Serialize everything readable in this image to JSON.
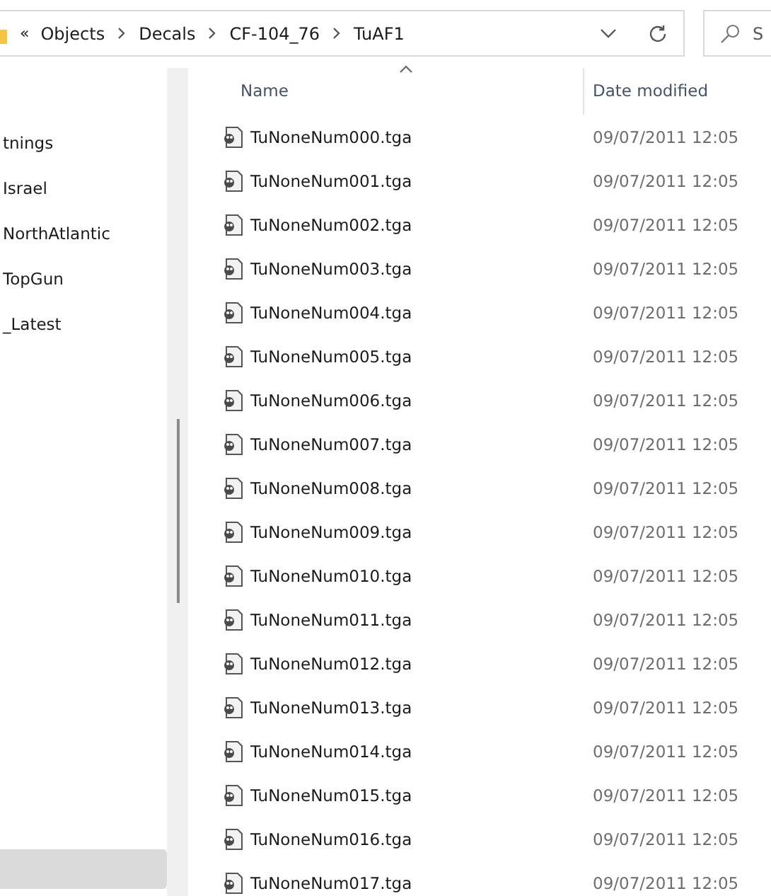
{
  "address_bar": {
    "overflow": "«",
    "crumbs": [
      "Objects",
      "Decals",
      "CF-104_76",
      "TuAF1"
    ]
  },
  "search": {
    "placeholder": "S"
  },
  "sidebar": {
    "items": [
      {
        "label": "tnings",
        "selected": false
      },
      {
        "label": "Israel",
        "selected": false
      },
      {
        "label": "NorthAtlantic",
        "selected": false
      },
      {
        "label": "TopGun",
        "selected": false
      },
      {
        "label": "_Latest",
        "selected": false
      }
    ],
    "highlighted_row": {
      "selected": true
    }
  },
  "table": {
    "columns": [
      {
        "label": "Name",
        "sorted": true
      },
      {
        "label": "Date modified",
        "sorted": false
      }
    ],
    "rows": [
      {
        "name": "TuNoneNum000.tga",
        "date": "09/07/2011 12:05"
      },
      {
        "name": "TuNoneNum001.tga",
        "date": "09/07/2011 12:05"
      },
      {
        "name": "TuNoneNum002.tga",
        "date": "09/07/2011 12:05"
      },
      {
        "name": "TuNoneNum003.tga",
        "date": "09/07/2011 12:05"
      },
      {
        "name": "TuNoneNum004.tga",
        "date": "09/07/2011 12:05"
      },
      {
        "name": "TuNoneNum005.tga",
        "date": "09/07/2011 12:05"
      },
      {
        "name": "TuNoneNum006.tga",
        "date": "09/07/2011 12:05"
      },
      {
        "name": "TuNoneNum007.tga",
        "date": "09/07/2011 12:05"
      },
      {
        "name": "TuNoneNum008.tga",
        "date": "09/07/2011 12:05"
      },
      {
        "name": "TuNoneNum009.tga",
        "date": "09/07/2011 12:05"
      },
      {
        "name": "TuNoneNum010.tga",
        "date": "09/07/2011 12:05"
      },
      {
        "name": "TuNoneNum011.tga",
        "date": "09/07/2011 12:05"
      },
      {
        "name": "TuNoneNum012.tga",
        "date": "09/07/2011 12:05"
      },
      {
        "name": "TuNoneNum013.tga",
        "date": "09/07/2011 12:05"
      },
      {
        "name": "TuNoneNum014.tga",
        "date": "09/07/2011 12:05"
      },
      {
        "name": "TuNoneNum015.tga",
        "date": "09/07/2011 12:05"
      },
      {
        "name": "TuNoneNum016.tga",
        "date": "09/07/2011 12:05"
      },
      {
        "name": "TuNoneNum017.tga",
        "date": "09/07/2011 12:05"
      }
    ]
  }
}
